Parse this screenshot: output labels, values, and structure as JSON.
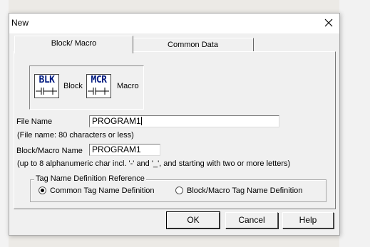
{
  "window": {
    "title": "New"
  },
  "tabs": [
    {
      "label": "Block/ Macro",
      "active": true
    },
    {
      "label": "Common Data",
      "active": false
    }
  ],
  "type_selector": {
    "block_glyph": "BLK",
    "block_label": "Block",
    "macro_glyph": "MCR",
    "macro_label": "Macro",
    "selected": "block"
  },
  "file_name": {
    "label": "File Name",
    "value": "PROGRAM1",
    "hint": "(File name: 80 characters or less)"
  },
  "block_macro_name": {
    "label": "Block/Macro Name",
    "value": "PROGRAM1",
    "hint": "(up to 8 alphanumeric char incl. '-' and '_', and starting with two or more letters)"
  },
  "tag_definition": {
    "legend": "Tag Name Definition Reference",
    "options": [
      {
        "label": "Common Tag Name Definition",
        "checked": true
      },
      {
        "label": "Block/Macro Tag Name Definition",
        "checked": false
      }
    ]
  },
  "buttons": {
    "ok": "OK",
    "cancel": "Cancel",
    "help": "Help"
  },
  "icons": [
    "close-icon",
    "block-icon",
    "macro-icon",
    "radio-icon"
  ]
}
